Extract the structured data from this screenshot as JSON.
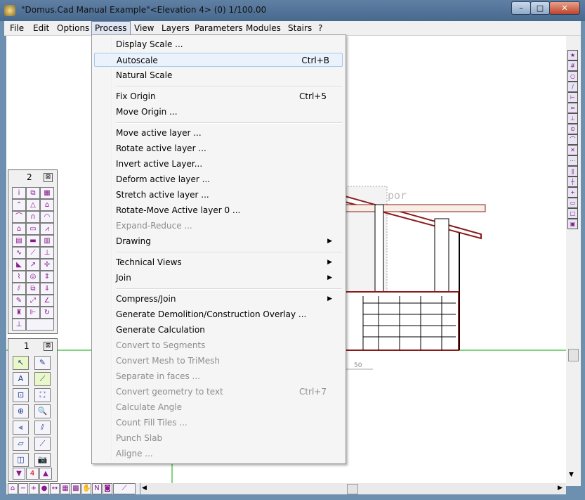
{
  "window": {
    "title": "\"Domus.Cad Manual Example\"<Elevation 4> (0) 1/100.00"
  },
  "window_controls": {
    "minimize": "–",
    "maximize": "□",
    "close": "✕"
  },
  "menubar": [
    "File",
    "Edit",
    "Options",
    "Process",
    "View",
    "Layers",
    "Parameters",
    "Modules",
    "Stairs",
    "?"
  ],
  "process_menu": {
    "items": [
      {
        "label": "Display Scale ...",
        "shortcut": "",
        "enabled": true
      },
      {
        "label": "Autoscale",
        "shortcut": "Ctrl+B",
        "enabled": true,
        "highlighted": true
      },
      {
        "label": "Natural Scale",
        "shortcut": "",
        "enabled": true
      },
      {
        "label": "Fix Origin",
        "shortcut": "Ctrl+5",
        "enabled": true
      },
      {
        "label": "Move Origin ...",
        "shortcut": "",
        "enabled": true
      },
      {
        "label": "Move active layer ...",
        "shortcut": "",
        "enabled": true
      },
      {
        "label": "Rotate active layer ...",
        "shortcut": "",
        "enabled": true
      },
      {
        "label": "Invert active Layer...",
        "shortcut": "",
        "enabled": true
      },
      {
        "label": "Deform active layer ...",
        "shortcut": "",
        "enabled": true
      },
      {
        "label": "Stretch active layer ...",
        "shortcut": "",
        "enabled": true
      },
      {
        "label": "Rotate-Move Active layer 0 ...",
        "shortcut": "",
        "enabled": true
      },
      {
        "label": "Expand-Reduce ...",
        "shortcut": "",
        "enabled": false
      },
      {
        "label": "Drawing",
        "shortcut": "",
        "enabled": true,
        "submenu": true
      },
      {
        "label": "Technical Views",
        "shortcut": "",
        "enabled": true,
        "submenu": true
      },
      {
        "label": "Join",
        "shortcut": "",
        "enabled": true,
        "submenu": true
      },
      {
        "label": "Compress/Join",
        "shortcut": "",
        "enabled": true,
        "submenu": true
      },
      {
        "label": "Generate Demolition/Construction Overlay ...",
        "shortcut": "",
        "enabled": true
      },
      {
        "label": "Generate Calculation",
        "shortcut": "",
        "enabled": true
      },
      {
        "label": "Convert to Segments",
        "shortcut": "",
        "enabled": false
      },
      {
        "label": "Convert Mesh to TriMesh",
        "shortcut": "",
        "enabled": false
      },
      {
        "label": "Separate in faces ...",
        "shortcut": "",
        "enabled": false
      },
      {
        "label": "Convert geometry to text",
        "shortcut": "Ctrl+7",
        "enabled": false
      },
      {
        "label": "Calculate Angle",
        "shortcut": "",
        "enabled": false
      },
      {
        "label": "Count Fill Tiles ...",
        "shortcut": "",
        "enabled": false
      },
      {
        "label": "Punch Slab",
        "shortcut": "",
        "enabled": false
      },
      {
        "label": "Aligne ...",
        "shortcut": "",
        "enabled": false
      }
    ],
    "submenu_arrow": "▶"
  },
  "panel2": {
    "number": "2",
    "close": "⊠"
  },
  "panel1": {
    "number": "1",
    "close": "⊠"
  },
  "canvas": {
    "dimension_text": "50",
    "watermark_text": "por"
  },
  "colors": {
    "menu_highlight": "#eaf2fb",
    "disabled_text": "#8d8d8d",
    "title_bar": "#4f7096",
    "drawing_red": "#8b1a1a",
    "axis_green": "#00aa00"
  }
}
